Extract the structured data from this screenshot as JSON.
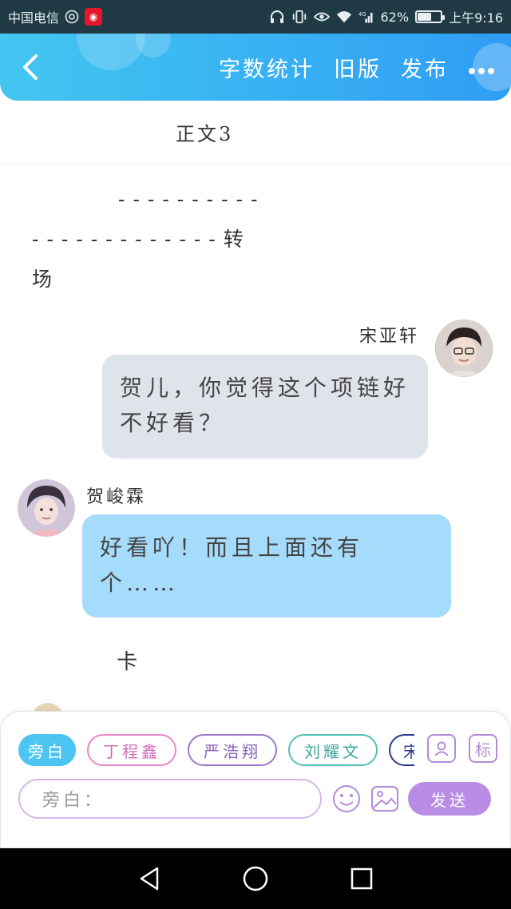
{
  "status_bar": {
    "carrier": "中国电信",
    "battery_percent": "62%",
    "battery_level": 0.62,
    "network": "4G",
    "time": "上午9:16"
  },
  "header": {
    "actions": {
      "word_count": "字数统计",
      "old_version": "旧版",
      "publish": "发布"
    }
  },
  "chapter": {
    "title": "正文3"
  },
  "narration": {
    "line1": "----------",
    "line2": "-------------转",
    "line3": "场"
  },
  "messages": [
    {
      "speaker": "宋亚轩",
      "text": "贺儿，你觉得这个项链好不好看？",
      "side": "right"
    },
    {
      "speaker": "贺峻霖",
      "text": "好看吖！而且上面还有个……",
      "side": "left"
    }
  ],
  "narration2": "卡",
  "composer": {
    "chips": [
      "旁白",
      "丁程鑫",
      "严浩翔",
      "刘耀文",
      "宋"
    ],
    "input_placeholder": "旁白：",
    "mark_label": "标",
    "send_label": "发送"
  },
  "colors": {
    "header_start": "#43c6f0",
    "header_end": "#2f9df4",
    "bubble_right": "#dfe4eb",
    "bubble_left": "#a6dcfb",
    "send_button": "#b98de6"
  }
}
